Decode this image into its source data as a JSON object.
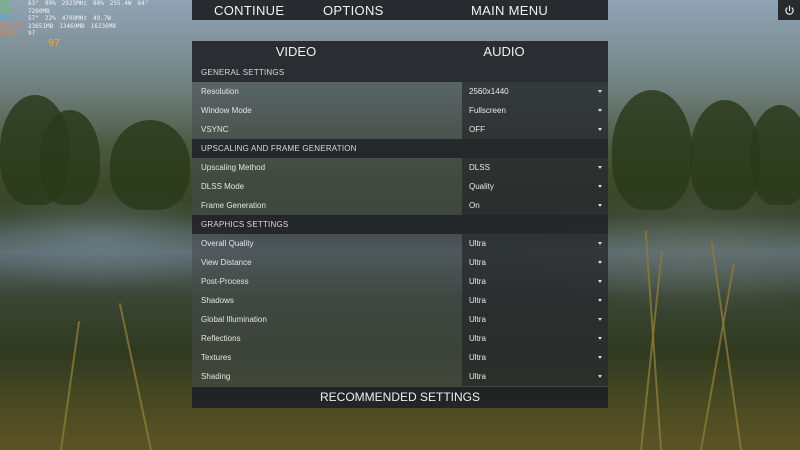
{
  "hud": {
    "rows": [
      {
        "label": "GPU",
        "values": [
          "63°",
          "99%",
          "2925MHz",
          "80%",
          "255.4W",
          "64°"
        ],
        "color": "#56c95a"
      },
      {
        "label": "VRAM",
        "values": [
          "7260MB"
        ],
        "color": "#56c95a"
      },
      {
        "label": "CPU",
        "values": [
          "57°",
          "22%",
          "4700MHz",
          "49.7W"
        ],
        "color": "#4aa8e0"
      },
      {
        "label": "MEMORY",
        "values": [
          "23651MB",
          "13469MB",
          "16236MB"
        ],
        "color": "#e07a4a"
      },
      {
        "label": "D3D12",
        "values": [
          "97"
        ],
        "color": "#e07a4a"
      }
    ],
    "fps": "97"
  },
  "top_menu": {
    "continue": "CONTINUE",
    "options": "OPTIONS",
    "main_menu": "MAIN MENU"
  },
  "tabs": {
    "video": "VIDEO",
    "audio": "AUDIO"
  },
  "sections": [
    {
      "title": "GENERAL SETTINGS",
      "rows": [
        {
          "label": "Resolution",
          "value": "2560x1440"
        },
        {
          "label": "Window Mode",
          "value": "Fullscreen"
        },
        {
          "label": "VSYNC",
          "value": "OFF"
        }
      ]
    },
    {
      "title": "UPSCALING AND FRAME GENERATION",
      "rows": [
        {
          "label": "Upscaling Method",
          "value": "DLSS"
        },
        {
          "label": "DLSS Mode",
          "value": "Quality"
        },
        {
          "label": "Frame Generation",
          "value": "On"
        }
      ]
    },
    {
      "title": "GRAPHICS SETTINGS",
      "rows": [
        {
          "label": "Overall Quality",
          "value": "Ultra"
        },
        {
          "label": "View Distance",
          "value": "Ultra"
        },
        {
          "label": "Post-Process",
          "value": "Ultra"
        },
        {
          "label": "Shadows",
          "value": "Ultra"
        },
        {
          "label": "Global Illumination",
          "value": "Ultra"
        },
        {
          "label": "Reflections",
          "value": "Ultra"
        },
        {
          "label": "Textures",
          "value": "Ultra"
        },
        {
          "label": "Shading",
          "value": "Ultra"
        }
      ]
    }
  ],
  "recommended": "RECOMMENDED SETTINGS",
  "icons": {
    "power": "power-icon",
    "dropdown": "chevron-down-icon"
  }
}
